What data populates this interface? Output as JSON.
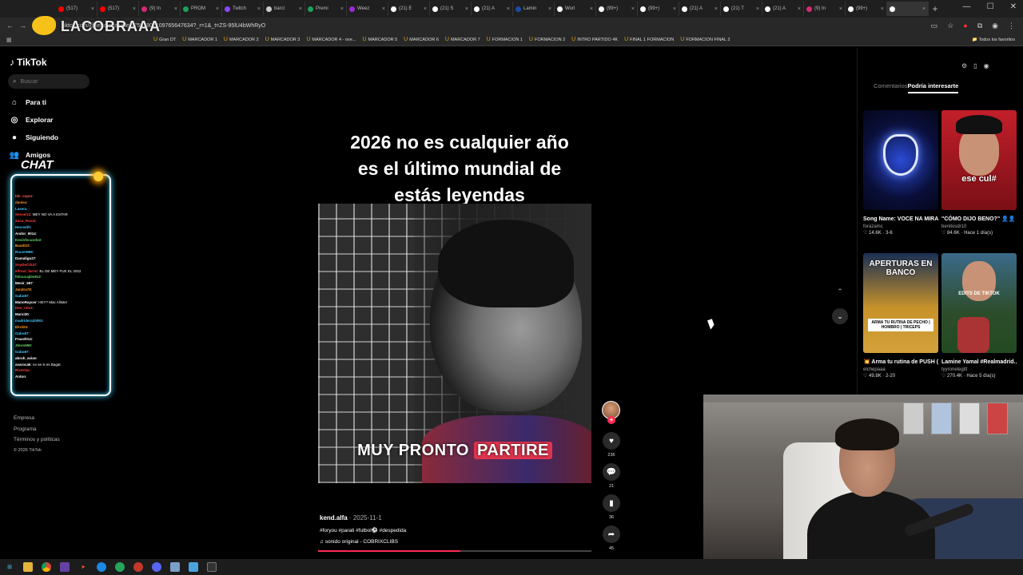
{
  "browser": {
    "tabs": [
      {
        "label": "(517)",
        "color": "#ff0000"
      },
      {
        "label": "(517)",
        "color": "#ff0000"
      },
      {
        "label": "(9) In",
        "color": "#d62976"
      },
      {
        "label": "PROM",
        "color": "#1fa05a"
      },
      {
        "label": "Twitch",
        "color": "#9146ff"
      },
      {
        "label": "barcl",
        "color": "#cccccc"
      },
      {
        "label": "Premi",
        "color": "#1fa05a"
      },
      {
        "label": "Weez",
        "color": "#9b2bd6"
      },
      {
        "label": "(21) E",
        "color": "#ffffff"
      },
      {
        "label": "(21) S",
        "color": "#ffffff"
      },
      {
        "label": "(21) A",
        "color": "#ffffff"
      },
      {
        "label": "Lamin",
        "color": "#1c4aa5"
      },
      {
        "label": "Worl",
        "color": "#ffffff"
      },
      {
        "label": "(99+)",
        "color": "#ffffff"
      },
      {
        "label": "(99+)",
        "color": "#ffffff"
      },
      {
        "label": "(21) A",
        "color": "#ffffff"
      },
      {
        "label": "(21) T",
        "color": "#ffffff"
      },
      {
        "label": "(21) A",
        "color": "#ffffff"
      },
      {
        "label": "(9) In",
        "color": "#d62976"
      },
      {
        "label": "(99+)",
        "color": "#ffffff"
      },
      {
        "label": "",
        "color": "#ffffff",
        "active": true
      }
    ],
    "new_tab": "+",
    "url": "tiktok.com/@kend.alfa/video/7567807109765647634?_r=1&_t=ZS-95lU4bWhRyO",
    "bookmarks": [
      "Gran DT",
      "MARCADOR 1",
      "MARCADOR 2",
      "MARCADOR 3",
      "MARCADOR 4 - ove...",
      "MARCADOR 5",
      "MARCADOR 6",
      "MARCADOR 7",
      "FORMACION 1",
      "FORMACION 2",
      "INTRO PARTIDO 4K",
      "FINAL 1 FORMACION",
      "FORMACION FINAL 2"
    ],
    "bookmarks_folder": "Todos los favoritos"
  },
  "overlay": {
    "streamer_name": "LACOBRAAA",
    "chat_title": "CHAT",
    "chat_messages": [
      {
        "user": "Ide_copor",
        "text": "",
        "color": "#ff5a5a"
      },
      {
        "user": "danlex",
        "text": "",
        "color": "#ff8a3a"
      },
      {
        "user": "Lasera_",
        "text": "",
        "color": "#44c8ff"
      },
      {
        "user": "Sensei11",
        "text": "MEY NO VA A ESTAR",
        "color": "#ff4040"
      },
      {
        "user": "Zacu_Rossi",
        "text": "",
        "color": "#ff4040"
      },
      {
        "user": "Hecneith",
        "text": "",
        "color": "#44c8ff"
      },
      {
        "user": "Andor_9014",
        "text": "",
        "color": "#ffffff"
      },
      {
        "user": "Kevinfecundo2",
        "text": "",
        "color": "#6ad46a"
      },
      {
        "user": "Bautil23",
        "text": "",
        "color": "#ff9a2a"
      },
      {
        "user": "Rocert999",
        "text": "",
        "color": "#44c8ff"
      },
      {
        "user": "Damaligo27",
        "text": "",
        "color": "#ffffff"
      },
      {
        "user": "SoyDeCib37",
        "text": "",
        "color": "#ff4040"
      },
      {
        "user": "elfrmd_farrer",
        "text": "EL DE MEY FUE EL 2022",
        "color": "#ff4040"
      },
      {
        "user": "felicucaji0s912",
        "text": "",
        "color": "#6ad46a"
      },
      {
        "user": "Mesir_567",
        "text": "",
        "color": "#ffffff"
      },
      {
        "user": "Jandra78",
        "text": "",
        "color": "#ff9a2a"
      },
      {
        "user": "Gabo87",
        "text": "",
        "color": "#44c8ff"
      },
      {
        "user": "ManoRaycer",
        "text": "HEY? Mac Allister",
        "color": "#ffffff"
      },
      {
        "user": "Den_relo1",
        "text": "",
        "color": "#ff4040"
      },
      {
        "user": "Marxi30",
        "text": "",
        "color": "#ffffff"
      },
      {
        "user": "madridera20091",
        "text": "",
        "color": "#44c8ff"
      },
      {
        "user": "Elrol24",
        "text": "",
        "color": "#ff9a2a"
      },
      {
        "user": "Gabo87",
        "text": "",
        "color": "#44c8ff"
      },
      {
        "user": "Fraxel014",
        "text": "",
        "color": "#ffffff"
      },
      {
        "user": "Jlmro999",
        "text": "",
        "color": "#6ad46a"
      },
      {
        "user": "Gabo87",
        "text": "",
        "color": "#44c8ff"
      },
      {
        "user": "abruh_avian",
        "text": "",
        "color": "#ffffff"
      },
      {
        "user": "avarocak",
        "text": "no se si es Bagat",
        "color": "#ffffff"
      },
      {
        "user": "Ricertas",
        "text": "",
        "color": "#ff4040"
      },
      {
        "user": "Anton",
        "text": "",
        "color": "#ffffff"
      }
    ]
  },
  "tiktok": {
    "logo": "TikTok",
    "search_placeholder": "Buscar",
    "nav": [
      {
        "label": "Para ti",
        "icon": "home-icon"
      },
      {
        "label": "Explorar",
        "icon": "compass-icon"
      },
      {
        "label": "Siguiendo",
        "icon": "following-icon"
      },
      {
        "label": "Amigos",
        "icon": "friends-icon"
      }
    ],
    "footer": [
      "Empresa",
      "Programa",
      "Términos y políticas",
      "© 2026 TikTok"
    ]
  },
  "video": {
    "caption_lines": [
      "2026 no es cualquier año",
      "es el último mundial de",
      "estás leyendas"
    ],
    "subtitle_plain": "MUY PRONTO",
    "subtitle_highlight": "PARTIRE",
    "author": "kend.alfa",
    "date": "2025-11-1",
    "hashtags": "#foryou #parati #futbol⚽ #despedida",
    "music": "sonido original - COBRIXCLIBS",
    "progress": 0.52,
    "likes": "236",
    "comments": "21",
    "saves": "36",
    "shares": "45",
    "follow_plus": "+"
  },
  "right_panel": {
    "tabs": [
      {
        "label": "Comentarios",
        "active": false
      },
      {
        "label": "Podría interesarte",
        "active": true
      }
    ],
    "cards": [
      {
        "title": "Song Name: VOCE NA MIRA #slowed #phon...",
        "author": "forazamc",
        "likes": "14.6K",
        "age": "3-6",
        "thumb_text": ""
      },
      {
        "title": "\"CÓMO DIJO BENO?\" 👤👤 #412 #benitosd...",
        "author": "benitosdr10",
        "likes": "84.6K",
        "age": "Hace 1 día(s)",
        "thumb_text": "ese cul#"
      },
      {
        "title": "💥 Arma tu rutina de PUSH (Pecho | Hombr...",
        "author": "elchepaaa",
        "likes": "49.8K",
        "age": "2-20",
        "thumb_text": "APERTURAS EN BANCO"
      },
      {
        "title": "Lamine Yamal #Realmadrid...",
        "author": "tyyronelegitt",
        "likes": "270.4K",
        "age": "Hace 5 día(s)",
        "thumb_text": "EDITS DE TIKTOK"
      }
    ],
    "card3_sub": "ARMA TU RUTINA DE PECHO | HOMBRO | TRICEPS"
  }
}
